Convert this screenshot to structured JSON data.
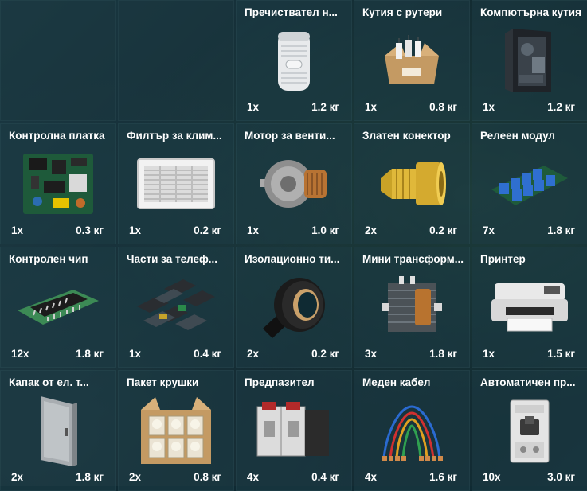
{
  "inventory": {
    "slots": [
      {
        "empty": true
      },
      {
        "empty": true
      },
      {
        "name": "Пречиствател н...",
        "qty": "1x",
        "weight": "1.2 кг",
        "icon": "air-purifier-icon"
      },
      {
        "name": "Кутия с рутери",
        "qty": "1x",
        "weight": "0.8 кг",
        "icon": "router-box-icon"
      },
      {
        "name": "Компютърна кутия",
        "qty": "1x",
        "weight": "1.2 кг",
        "icon": "pc-case-icon"
      },
      {
        "name": "Контролна платка",
        "qty": "1x",
        "weight": "0.3 кг",
        "icon": "control-board-icon"
      },
      {
        "name": "Филтър за клим...",
        "qty": "1x",
        "weight": "0.2 кг",
        "icon": "ac-filter-icon"
      },
      {
        "name": "Мотор за венти...",
        "qty": "1x",
        "weight": "1.0 кг",
        "icon": "fan-motor-icon"
      },
      {
        "name": "Златен конектор",
        "qty": "2x",
        "weight": "0.2 кг",
        "icon": "gold-connector-icon"
      },
      {
        "name": "Релеен модул",
        "qty": "7x",
        "weight": "1.8 кг",
        "icon": "relay-module-icon"
      },
      {
        "name": "Контролен чип",
        "qty": "12x",
        "weight": "1.8 кг",
        "icon": "control-chip-icon"
      },
      {
        "name": "Части за телеф...",
        "qty": "1x",
        "weight": "0.4 кг",
        "icon": "phone-parts-icon"
      },
      {
        "name": "Изолационно ти...",
        "qty": "2x",
        "weight": "0.2 кг",
        "icon": "insulation-tape-icon"
      },
      {
        "name": "Мини трансформ...",
        "qty": "3x",
        "weight": "1.8 кг",
        "icon": "mini-transformer-icon"
      },
      {
        "name": "Принтер",
        "qty": "1x",
        "weight": "1.5 кг",
        "icon": "printer-icon"
      },
      {
        "name": "Капак от ел. т...",
        "qty": "2x",
        "weight": "1.8 кг",
        "icon": "electrical-panel-cover-icon"
      },
      {
        "name": "Пакет крушки",
        "qty": "2x",
        "weight": "0.8 кг",
        "icon": "light-bulb-pack-icon"
      },
      {
        "name": "Предпазител",
        "qty": "4x",
        "weight": "0.4 кг",
        "icon": "fuse-icon"
      },
      {
        "name": "Меден кабел",
        "qty": "4x",
        "weight": "1.6 кг",
        "icon": "copper-cable-icon"
      },
      {
        "name": "Автоматичен пр...",
        "qty": "10x",
        "weight": "3.0 кг",
        "icon": "circuit-breaker-icon"
      }
    ]
  }
}
